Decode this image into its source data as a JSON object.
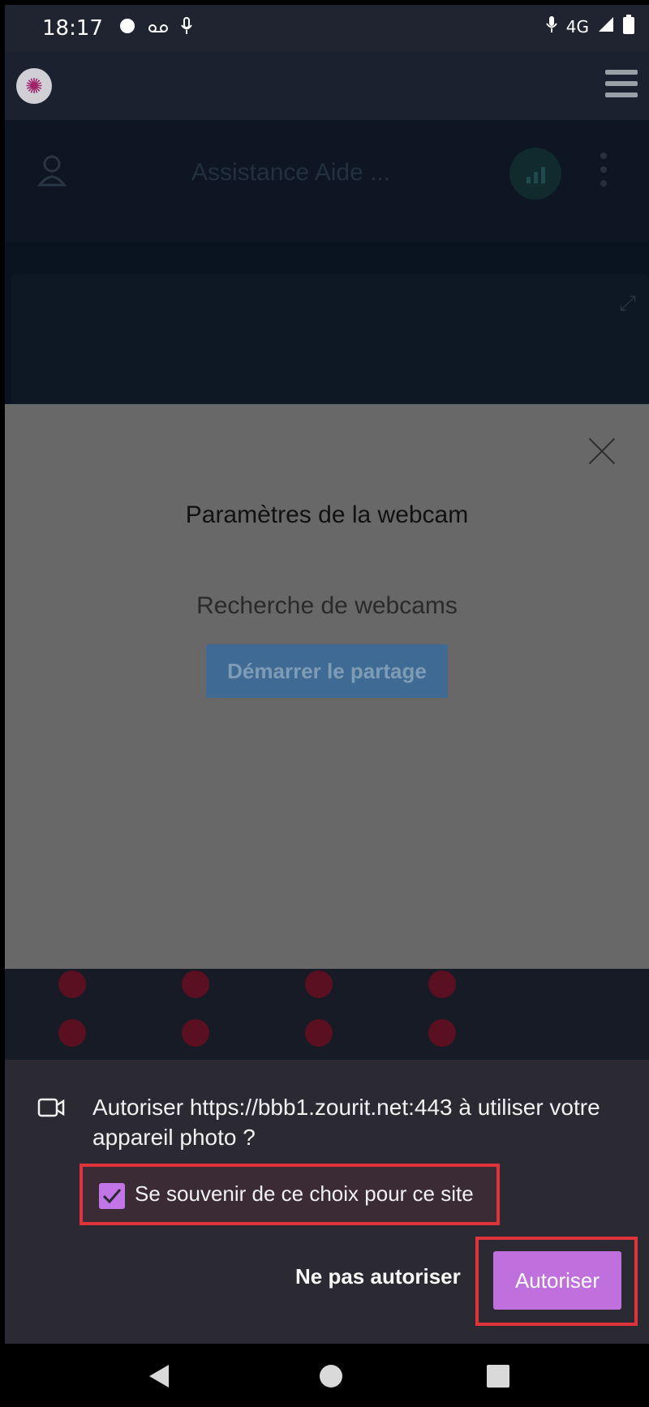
{
  "status_bar": {
    "time": "18:17",
    "network": "4G"
  },
  "app_header": {
    "logo_icon": "octopus-logo-icon",
    "menu_icon": "hamburger-icon"
  },
  "conference": {
    "title": "Assistance Aide ..."
  },
  "webcam_modal": {
    "title": "Paramètres de la webcam",
    "status": "Recherche de webcams",
    "start_button": "Démarrer le partage"
  },
  "permission_prompt": {
    "message": "Autoriser https://bbb1.zourit.net:443 à utiliser votre appareil photo ?",
    "remember_label": "Se souvenir de ce choix pour ce site",
    "remember_checked": true,
    "deny_button": "Ne pas autoriser",
    "allow_button": "Autoriser",
    "accent_color": "#c070dd",
    "highlight_color": "#e0343c"
  }
}
